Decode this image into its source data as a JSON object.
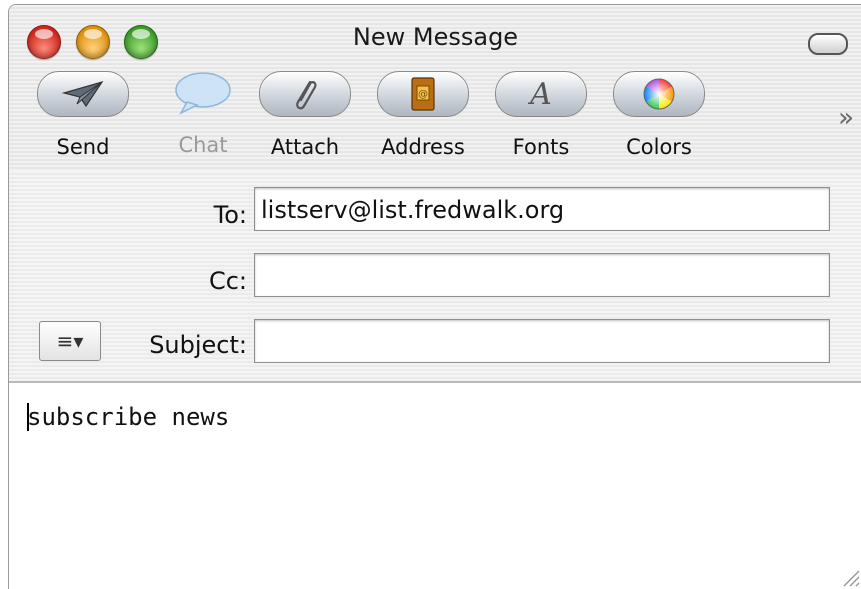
{
  "window": {
    "title": "New Message"
  },
  "toolbar": {
    "buttons": [
      {
        "label": "Send",
        "icon": "paper-plane-icon"
      },
      {
        "label": "Chat",
        "icon": "speech-bubble-icon",
        "disabled": true
      },
      {
        "label": "Attach",
        "icon": "paperclip-icon"
      },
      {
        "label": "Address",
        "icon": "address-book-icon"
      },
      {
        "label": "Fonts",
        "icon": "font-a-icon"
      },
      {
        "label": "Colors",
        "icon": "color-wheel-icon"
      }
    ],
    "overflow": "»"
  },
  "fields": {
    "to_label": "To:",
    "to_value": "listserv@list.fredwalk.org",
    "cc_label": "Cc:",
    "cc_value": "",
    "subject_label": "Subject:",
    "subject_value": "",
    "account_menu": "≡▾"
  },
  "message": {
    "body": "subscribe news"
  },
  "colors": {
    "close": "#d2281c",
    "minimize": "#e29410",
    "zoom": "#3f9e28"
  }
}
